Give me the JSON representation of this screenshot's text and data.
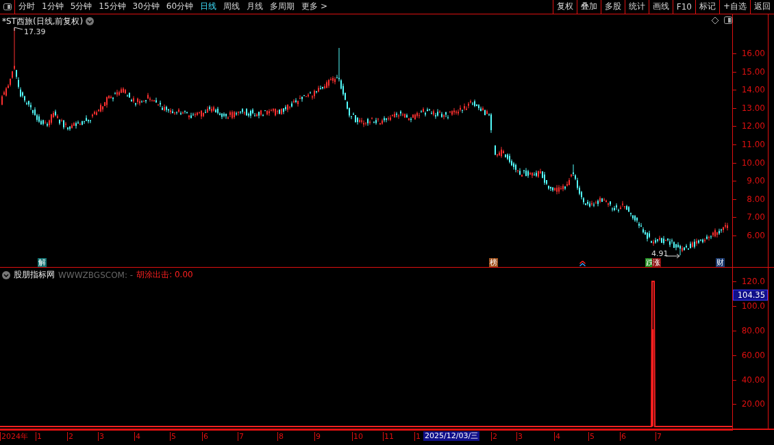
{
  "toolbar": {
    "periods": [
      {
        "label": "分时",
        "selected": false
      },
      {
        "label": "1分钟",
        "selected": false
      },
      {
        "label": "5分钟",
        "selected": false
      },
      {
        "label": "15分钟",
        "selected": false
      },
      {
        "label": "30分钟",
        "selected": false
      },
      {
        "label": "60分钟",
        "selected": false
      },
      {
        "label": "日线",
        "selected": true
      },
      {
        "label": "周线",
        "selected": false
      },
      {
        "label": "月线",
        "selected": false
      },
      {
        "label": "多周期",
        "selected": false
      },
      {
        "label": "更多 >",
        "selected": false
      }
    ],
    "actions": [
      "复权",
      "叠加",
      "多股",
      "统计",
      "画线",
      "F10",
      "标记",
      "+自选",
      "返回"
    ]
  },
  "main_chart": {
    "title": "*ST西旅(日线,前复权)",
    "high_label": "17.39",
    "low_label": "4.91",
    "y_ticks": [
      "16.00",
      "15.00",
      "14.00",
      "13.00",
      "12.00",
      "11.00",
      "10.00",
      "9.00",
      "8.00",
      "7.00",
      "6.00"
    ],
    "event_markers": [
      {
        "kind": "label",
        "text": "解",
        "color": "#0e7070"
      },
      {
        "kind": "label",
        "text": "榜",
        "color": "#a0521e"
      },
      {
        "kind": "arrow"
      },
      {
        "kind": "label",
        "text": "跌",
        "color": "#1a8a1a"
      },
      {
        "kind": "label",
        "text": "涨",
        "color": "#8b1010"
      },
      {
        "kind": "label",
        "text": "财",
        "color": "#1a3a70"
      }
    ]
  },
  "indicator": {
    "name": "股朋指标网",
    "source": "WWWZBGSCOM: -",
    "series_label": "胡涂出击: 0.00",
    "current_value": "104.35",
    "y_ticks": [
      "120.0",
      "100.0",
      "80.00",
      "60.00",
      "40.00",
      "20.00"
    ]
  },
  "time_axis": {
    "labels": [
      "2024年",
      "1",
      "2",
      "3",
      "4",
      "5",
      "6",
      "7",
      "8",
      "9",
      "10",
      "11",
      "1",
      "2",
      "3",
      "4",
      "5",
      "6",
      "7"
    ],
    "cursor_date": "2025/12/03/三"
  }
}
